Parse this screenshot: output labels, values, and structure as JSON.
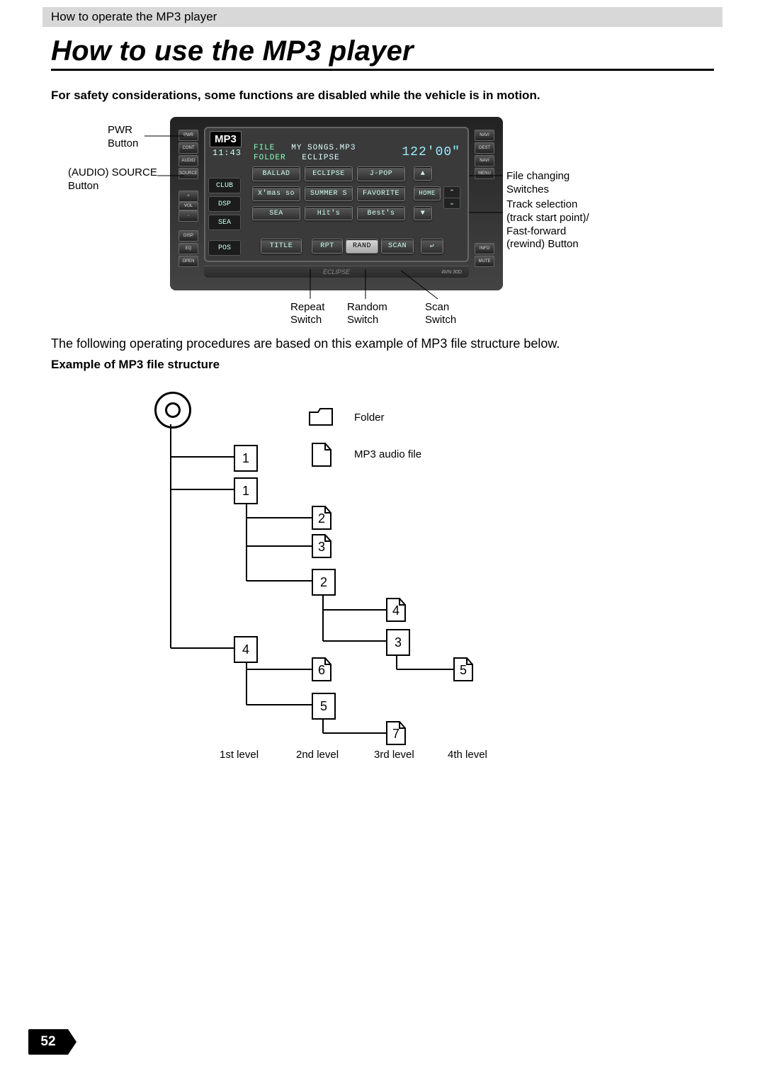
{
  "header": {
    "section": "How to operate the MP3 player",
    "title": "How to use the MP3 player"
  },
  "safety_note": "For safety considerations, some functions are disabled while the vehicle is in motion.",
  "device": {
    "mode_badge": "MP3",
    "clock": "11:43",
    "file_label": "FILE",
    "file_name": "MY SONGS.MP3",
    "folder_label": "FOLDER",
    "folder_name": "ECLIPSE",
    "track_time": "122'00\"",
    "brand": "ECLIPSE",
    "model": "AVN 30D",
    "side_labels": [
      "CLUB",
      "DSP",
      "SEA",
      "POS"
    ],
    "grid": {
      "r1": [
        "BALLAD",
        "ECLIPSE",
        "J-POP"
      ],
      "r2": [
        "X'mas so",
        "SUMMER S",
        "FAVORITE"
      ],
      "r3": [
        "SEA",
        "Hit's",
        "Best's"
      ]
    },
    "bottom_row": [
      "TITLE",
      "RPT",
      "RAND",
      "SCAN"
    ],
    "home_btn": "HOME",
    "hw_left": [
      "PWR",
      "CONT",
      "AUDIO",
      "SOURCE",
      "+",
      "VOL",
      "-",
      "DISP",
      "EQ",
      "OPEN"
    ],
    "hw_right": [
      "NAVI",
      "DEST",
      "NAVI",
      "MENU",
      "INFO",
      "MUTE"
    ]
  },
  "callouts": {
    "pwr": "PWR\nButton",
    "audio_source": "(AUDIO) SOURCE\nButton",
    "file_changing": "File changing\nSwitches",
    "track_sel": "Track selection\n(track start point)/\nFast-forward\n(rewind) Button",
    "repeat": "Repeat\nSwitch",
    "random": "Random\nSwitch",
    "scan": "Scan\nSwitch"
  },
  "body_para": "The following operating procedures are based on this example of MP3 file structure below.",
  "subheading": "Example of MP3 file structure",
  "structure": {
    "legend_folder": "Folder",
    "legend_file": "MP3 audio file",
    "levels": [
      "1st level",
      "2nd level",
      "3rd level",
      "4th level"
    ],
    "folders": [
      "1",
      "1",
      "2",
      "4",
      "3",
      "5"
    ],
    "files": [
      "2",
      "3",
      "4",
      "6",
      "5",
      "7"
    ]
  },
  "page_number": "52"
}
